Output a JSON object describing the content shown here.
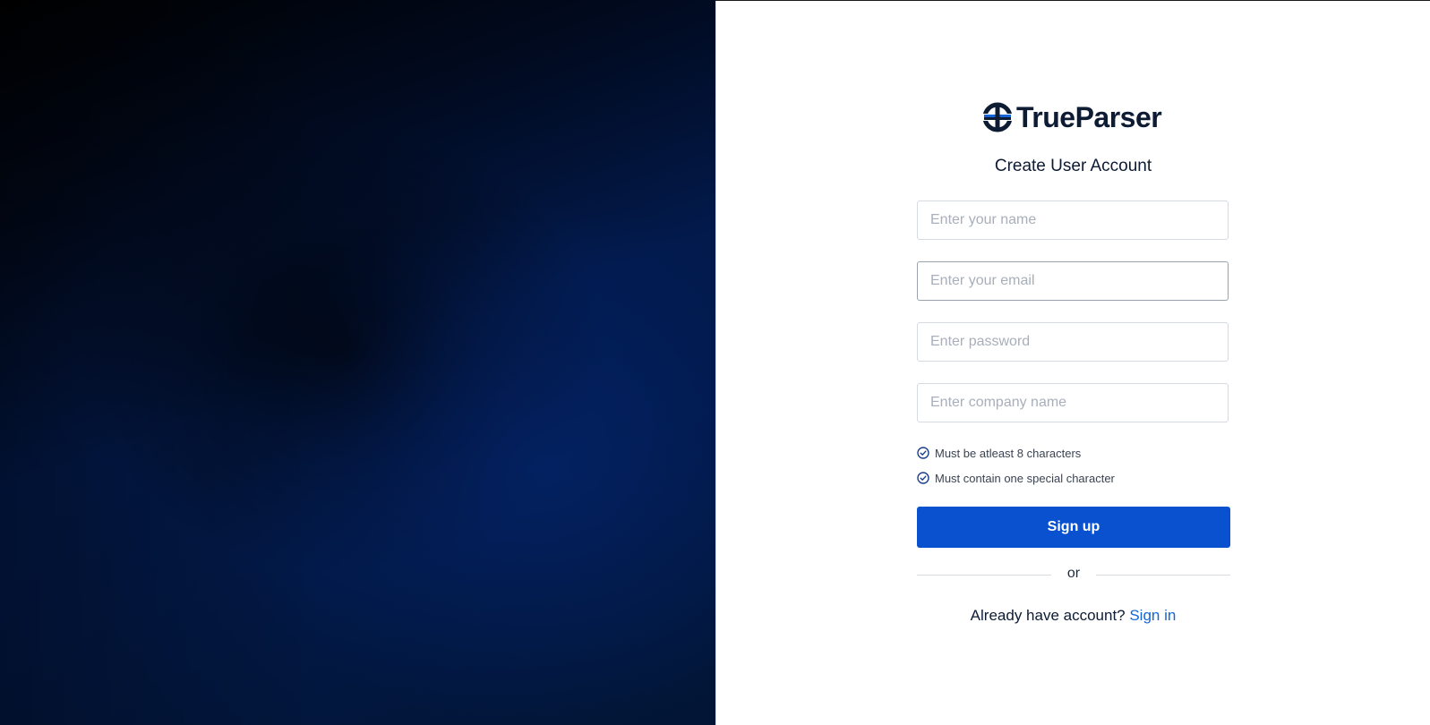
{
  "brand": {
    "name": "TrueParser",
    "logo_icon": "trueparser-logo-icon",
    "primary_color": "#0a51cf",
    "text_color": "#0d1b33"
  },
  "form": {
    "title": "Create User Account",
    "fields": {
      "name_placeholder": "Enter your name",
      "email_placeholder": "Enter your email",
      "password_placeholder": "Enter password",
      "company_placeholder": "Enter company name"
    },
    "password_rules": [
      {
        "icon": "check-circle-icon",
        "text": "Must be atleast 8 characters"
      },
      {
        "icon": "check-circle-icon",
        "text": "Must contain one special character"
      }
    ],
    "submit_label": "Sign up",
    "divider_text": "or",
    "signin_prompt": "Already have account?",
    "signin_link": "Sign in",
    "link_color": "#1565d8"
  }
}
